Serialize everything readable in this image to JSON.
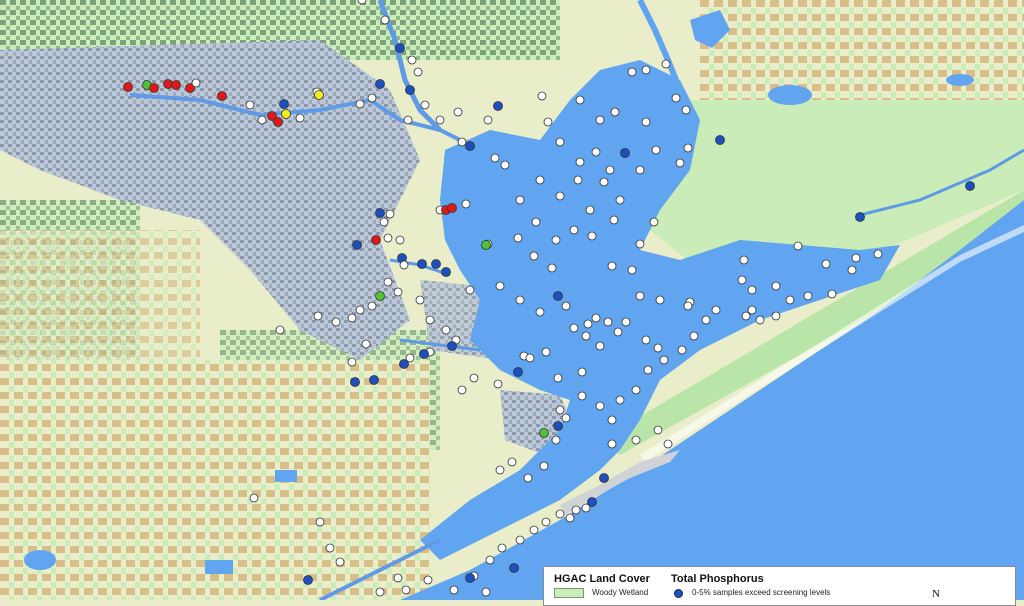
{
  "colors": {
    "land": "#e9edc9",
    "wetland": "#c9ecb8",
    "forest": "#6f9b72",
    "agri": "#d7bf8a",
    "urban": "#9aa2ab",
    "urban_light": "#b9c8dc",
    "water": "#61a4ef",
    "river": "#5e9ae6",
    "marker_outline": "#333333",
    "class_0_5": "#1e4fbf",
    "class_red": "#e01818",
    "class_green": "#4fc236",
    "class_yellow": "#f0ec20",
    "class_unsampled": "#ffffff"
  },
  "legend": {
    "land_cover_title": "HGAC Land Cover",
    "phosphorus_title": "Total Phosphorus",
    "woody_wetland_label": "Woody Wetland",
    "class_0_5_label": "0-5% samples exceed screening levels",
    "north_label": "N"
  }
}
